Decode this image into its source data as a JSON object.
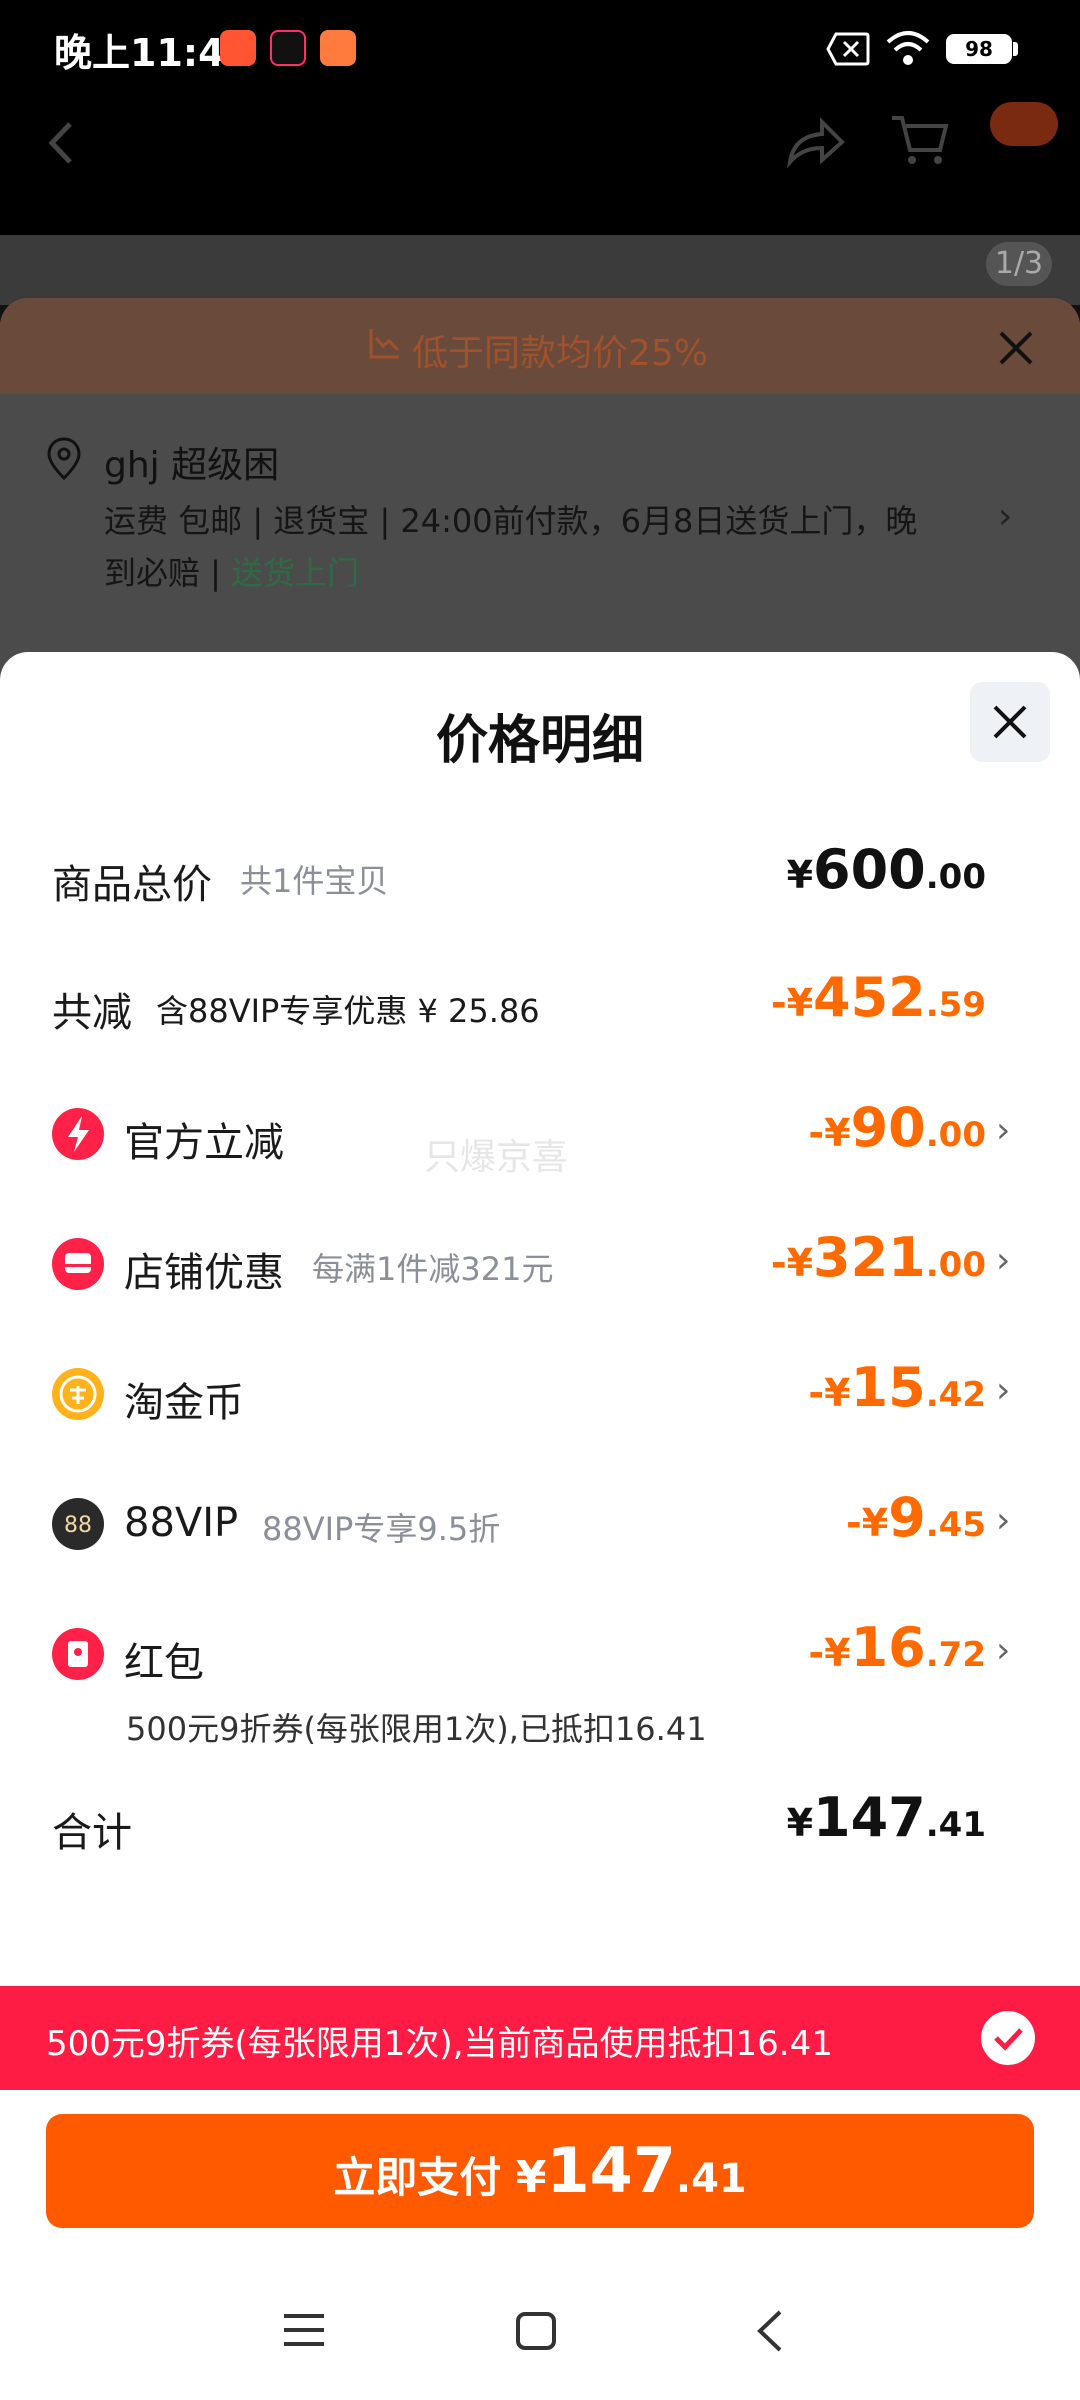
{
  "status_bar": {
    "time": "晚上11:42",
    "battery": "98"
  },
  "background_page": {
    "image_counter": "1/3",
    "price_banner": "低于同款均价25%",
    "address_name": "ghj 超级困",
    "shipping_line1": "运费 包邮 | 退货宝 | 24:00前付款，6月8日送货上门，晚",
    "shipping_line2_prefix": "到必赔 | ",
    "shipping_line2_green": "送货上门"
  },
  "sheet": {
    "title": "价格明细",
    "watermark": "只爆京喜",
    "rows": {
      "total": {
        "label": "商品总价",
        "sub": "共1件宝贝",
        "sym": "¥",
        "int": "600",
        "dec": ".00"
      },
      "reduce": {
        "label": "共减",
        "sub": "含88VIP专享优惠 ¥ 25.86",
        "sym": "-¥",
        "int": "452",
        "dec": ".59"
      },
      "official": {
        "label": "官方立减",
        "sym": "-¥",
        "int": "90",
        "dec": ".00"
      },
      "store": {
        "label": "店铺优惠",
        "sub": "每满1件减321元",
        "sym": "-¥",
        "int": "321",
        "dec": ".00"
      },
      "coin": {
        "label": "淘金币",
        "sym": "-¥",
        "int": "15",
        "dec": ".42"
      },
      "vip": {
        "label": "88VIP",
        "sub": "88VIP专享9.5折",
        "sym": "-¥",
        "int": "9",
        "dec": ".45"
      },
      "redpack": {
        "label": "红包",
        "note": "500元9折券(每张限用1次),已抵扣16.41",
        "sym": "-¥",
        "int": "16",
        "dec": ".72"
      },
      "sum": {
        "label": "合计",
        "sym": "¥",
        "int": "147",
        "dec": ".41"
      }
    }
  },
  "tip_bar": {
    "text": "500元9折券(每张限用1次),当前商品使用抵扣16.41"
  },
  "pay_button": {
    "label": "立即支付",
    "sym": "¥",
    "int": "147",
    "dec": ".41"
  },
  "colors": {
    "accent": "#ff5a00",
    "discount": "#ff6a00",
    "tip": "#ff1c44"
  }
}
